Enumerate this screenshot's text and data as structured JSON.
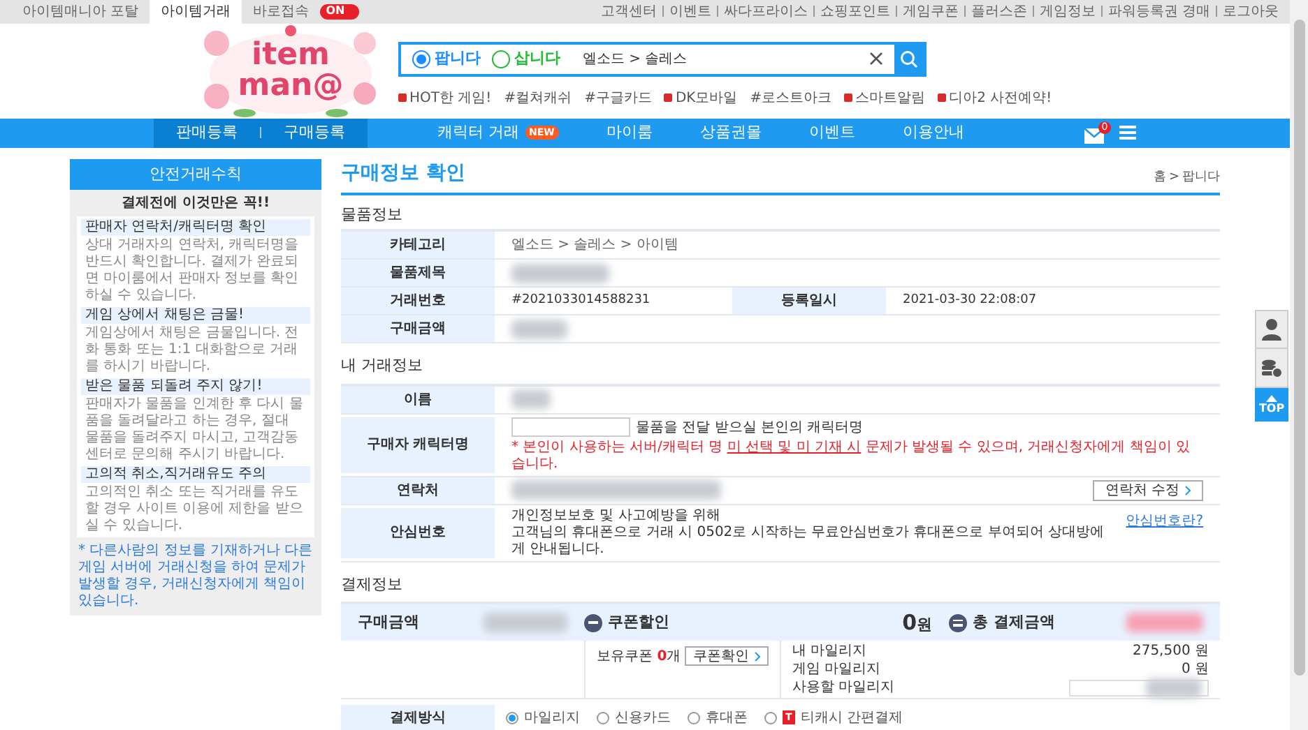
{
  "top_bar": {
    "tabs": [
      {
        "label": "아이템매니아 포탈",
        "selected": false
      },
      {
        "label": "아이템거래",
        "selected": true
      }
    ],
    "quick_access": {
      "label": "바로접속",
      "toggle_text": "ON",
      "on": true
    },
    "links": [
      "고객센터",
      "이벤트",
      "싸다프라이스",
      "쇼핑포인트",
      "게임쿠폰",
      "플러스존",
      "게임정보",
      "파워등록권 경매",
      "로그아웃"
    ]
  },
  "logo": {
    "lines": [
      "item",
      "man@"
    ]
  },
  "search": {
    "modes": [
      {
        "label": "팝니다",
        "selected": true,
        "color": "#1a8cff"
      },
      {
        "label": "삽니다",
        "selected": false,
        "color": "#22bb33"
      }
    ],
    "value": "엘소드 > 솔레스",
    "hot_tags": [
      {
        "label": "HOT한 게임!",
        "kind": "badge"
      },
      {
        "label": "#컬쳐캐쉬",
        "kind": "hash"
      },
      {
        "label": "#구글카드",
        "kind": "hash"
      },
      {
        "label": "DK모바일",
        "kind": "badge"
      },
      {
        "label": "#로스트아크",
        "kind": "hash"
      },
      {
        "label": "스마트알림",
        "kind": "badge"
      },
      {
        "label": "디아2 사전예약!",
        "kind": "badge"
      }
    ]
  },
  "nav": {
    "register": [
      "판매등록",
      "구매등록"
    ],
    "items": [
      {
        "label": "캐릭터 거래",
        "badge": "NEW"
      },
      {
        "label": "마이룸"
      },
      {
        "label": "상품권몰"
      },
      {
        "label": "이벤트"
      },
      {
        "label": "이용안내"
      }
    ],
    "mail_count": "0"
  },
  "sidebar": {
    "title": "안전거래수칙",
    "subtitle": "결제전에 이것만은 꼭!!",
    "rules": [
      {
        "heading": "판매자 연락처/캐릭터명 확인",
        "text": "상대 거래자의 연락처, 캐릭터명을 반드시 확인합니다. 결제가 완료되면 마이룸에서 판매자 정보를 확인하실 수 있습니다."
      },
      {
        "heading": "게임 상에서 채팅은 금물!",
        "text": "게임상에서 채팅은 금물입니다. 전화 통화 또는 1:1 대화함으로 거래를 하시기 바랍니다."
      },
      {
        "heading": "받은 물품 되돌려 주지 않기!",
        "text": "판매자가 물품을 인계한 후 다시 물품을 돌려달라고 하는 경우, 절대 물품을 돌려주지 마시고, 고객감동센터로 문의해 주시기 바랍니다."
      },
      {
        "heading": "고의적 취소,직거래유도 주의",
        "text": "고의적인 취소 또는 직거래를 유도할 경우 사이트 이용에 제한을 받으실 수 있습니다."
      }
    ],
    "note": "* 다른사람의 정보를 기재하거나 다른 게임 서버에 거래신청을 하여 문제가 발생할 경우, 거래신청자에게 책임이 있습니다."
  },
  "page_title": "구매정보 확인",
  "breadcrumb": [
    "홈",
    "팝니다"
  ],
  "breadcrumb_separator": ">",
  "top_button": "TOP",
  "item_info": {
    "title": "물품정보",
    "category_label": "카테고리",
    "category": "엘소드 > 솔레스 > 아이템",
    "subject_label": "물품제목",
    "trade_no_label": "거래번호",
    "trade_no": "#2021033014588231",
    "date_label": "등록일시",
    "date": "2021-03-30 22:08:07",
    "price_label": "구매금액"
  },
  "my_info": {
    "title": "내 거래정보",
    "name_label": "이름",
    "character_label": "구매자 캐릭터명",
    "character_hint": "물품을 전달 받으실 본인의 캐릭터명",
    "warning_before": "* 본인이 사용하는 서버/캐릭터 명 ",
    "warning_link": "미 선택 및 미 기재 시",
    "warning_after": " 문제가 발생될 수 있으며, 거래신청자에게 책임이 있습니다.",
    "contact_label": "연락처",
    "contact_button": "연락처 수정",
    "safe_label": "안심번호",
    "safe_lines": [
      "개인정보보호 및 사고예방을 위해",
      "고객님의 휴대폰으로 거래 시 0502로 시작하는 무료안심번호가 휴대폰으로 부여되어 상대방에게 안내됩니다."
    ],
    "safe_link": "안심번호란?"
  },
  "payment": {
    "title": "결제정보",
    "price_label": "구매금액",
    "coupon_label": "쿠폰할인",
    "coupon_amount": "0",
    "won": "원",
    "total_label": "총 결제금액",
    "coupons_label": "보유쿠폰",
    "coupons_count": "0",
    "coupons_unit": "개",
    "coupon_button": "쿠폰확인",
    "mileage": [
      {
        "label": "내 마일리지",
        "value": "275,500 원"
      },
      {
        "label": "게임 마일리지",
        "value": "0 원"
      },
      {
        "label": "사용할 마일리지",
        "kind": "field"
      }
    ],
    "method_label": "결제방식",
    "methods": [
      {
        "label": "마일리지",
        "selected": true
      },
      {
        "label": "신용카드",
        "selected": false
      },
      {
        "label": "휴대폰",
        "selected": false
      },
      {
        "label": "티캐시 간편결제",
        "selected": false,
        "badge": "T"
      }
    ]
  }
}
